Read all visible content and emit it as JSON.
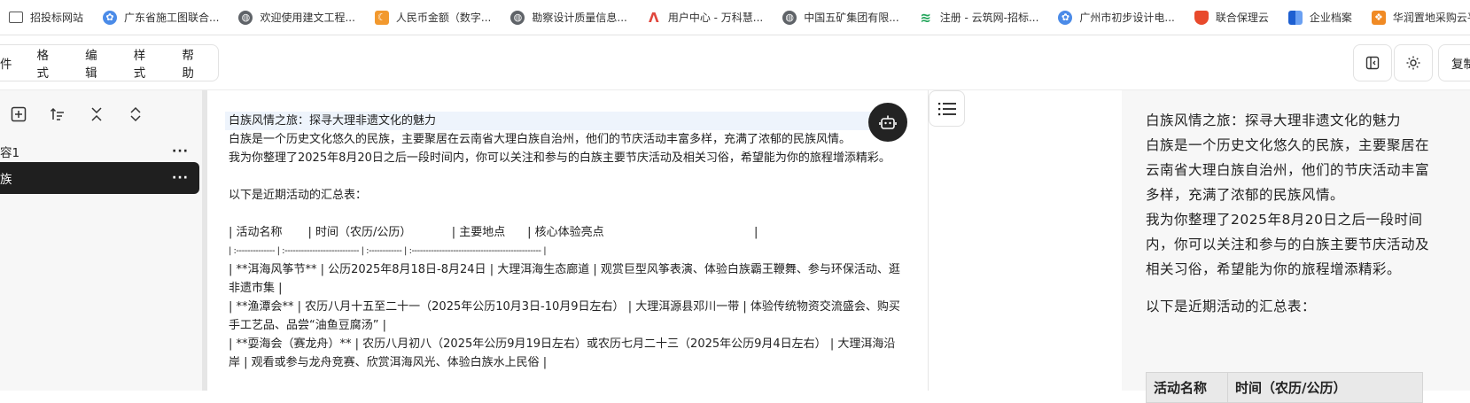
{
  "bookmarks": [
    {
      "label": "招投标网站",
      "icon": "folder-icon"
    },
    {
      "label": "广东省施工图联合...",
      "icon": "blue-flower-icon"
    },
    {
      "label": "欢迎使用建文工程...",
      "icon": "globe-icon"
    },
    {
      "label": "人民币金额（数字...",
      "icon": "orange-moon-icon"
    },
    {
      "label": "勘察设计质量信息...",
      "icon": "globe-icon"
    },
    {
      "label": "用户中心 - 万科慧...",
      "icon": "red-a-icon"
    },
    {
      "label": "中国五矿集团有限...",
      "icon": "globe-icon"
    },
    {
      "label": "注册 - 云筑网-招标...",
      "icon": "green-wave-icon"
    },
    {
      "label": "广州市初步设计电...",
      "icon": "blue-flower-icon"
    },
    {
      "label": "联合保理云",
      "icon": "shield-icon"
    },
    {
      "label": "企业档案",
      "icon": "stripe-icon"
    },
    {
      "label": "华润置地采购云平台",
      "icon": "orange-icon"
    }
  ],
  "menu": [
    "件",
    "格式",
    "编辑",
    "样式",
    "帮助"
  ],
  "topright": {
    "save_label": "复制"
  },
  "sidebar": {
    "items": [
      {
        "label": "容1",
        "active": false
      },
      {
        "label": "族",
        "active": true
      }
    ]
  },
  "editor": {
    "lines": [
      "白族风情之旅：探寻大理非遗文化的魅力",
      "白族是一个历史文化悠久的民族，主要聚居在云南省大理白族自治州，他们的节庆活动丰富多样，充满了浓郁的民族风情。",
      "我为你整理了2025年8月20日之后一段时间内，你可以关注和参与的白族主要节庆活动及相关习俗，希望能为你的旅程增添精彩。",
      "",
      "以下是近期活动的汇总表：",
      "",
      "| 活动名称       | 时间（农历/公历）           | 主要地点      | 核心体验亮点                                         |",
      "| :-------------- | :--------------------------- | :------------ | :----------------------------------------------- |",
      "| **洱海风筝节**  | 公历2025年8月18日-8月24日    | 大理洱海生态廊道 | 观赏巨型风筝表演、体验白族霸王鞭舞、参与环保活动、逛非遗市集 |",
      "| **渔潭会**      | 农历八月十五至二十一（2025年公历10月3日-10月9日左右） | 大理洱源县邓川一带 | 体验传统物资交流盛会、购买手工艺品、品尝“油鱼豆腐汤”     |",
      "| **耍海会（赛龙舟）** | 农历八月初八（2025年公历9月19日左右）或农历七月二十三（2025年公历9月4日左右） | 大理洱海沿岸     | 观看或参与龙舟竞赛、欣赏洱海风光、体验白族水上民俗       |"
    ]
  },
  "preview": {
    "title": "白族风情之旅：探寻大理非遗文化的魅力",
    "para1": "白族是一个历史文化悠久的民族，主要聚居在云南省大理白族自治州，他们的节庆活动丰富多样，充满了浓郁的民族风情。",
    "para2": "我为你整理了2025年8月20日之后一段时间内，你可以关注和参与的白族主要节庆活动及相关习俗，希望能为你的旅程增添精彩。",
    "para3": "以下是近期活动的汇总表：",
    "table_headers": [
      "活动名称",
      "时间（农历/公历）"
    ]
  }
}
